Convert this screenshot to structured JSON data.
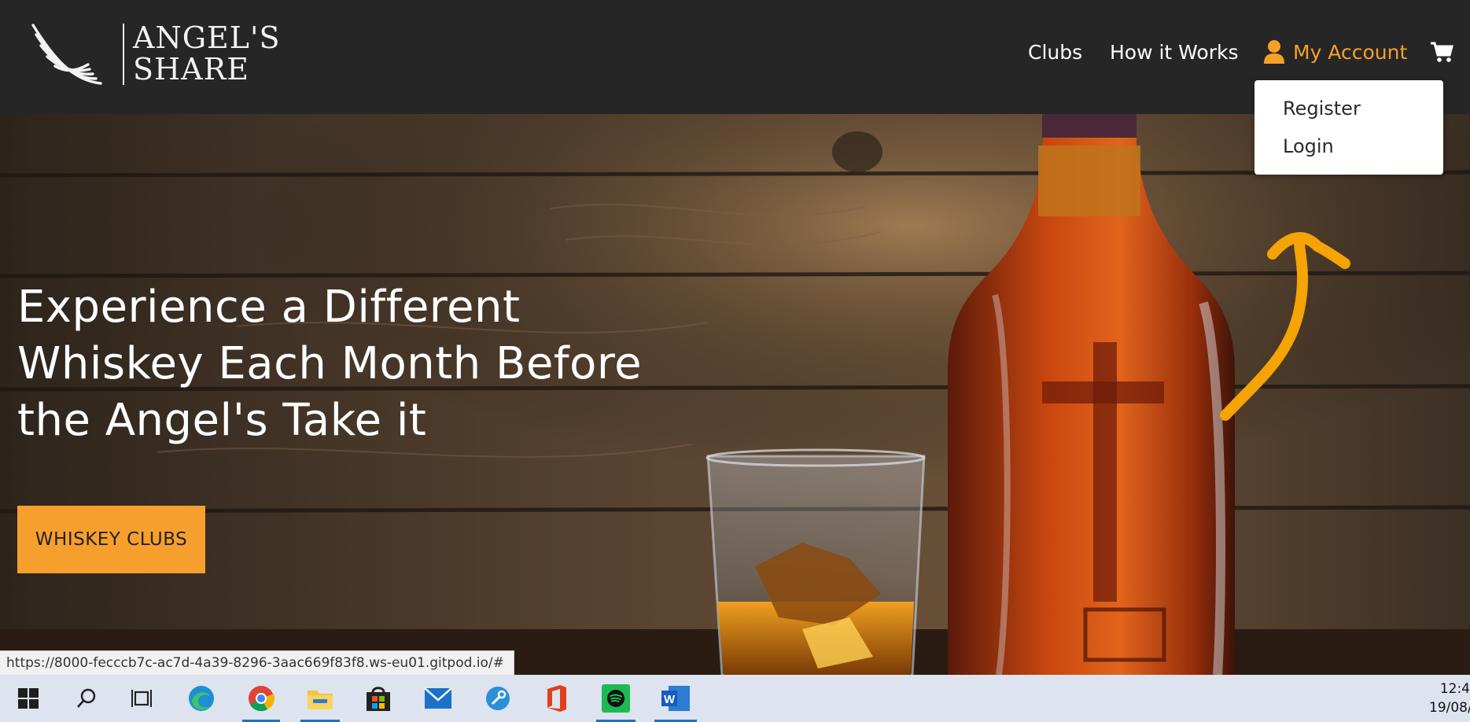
{
  "brand": {
    "logo_line1": "ANGEL'S",
    "logo_line2": "SHARE"
  },
  "nav": {
    "clubs": "Clubs",
    "how_it_works": "How it Works",
    "my_account": "My Account",
    "account_color": "#f5a028"
  },
  "account_menu": {
    "register": "Register",
    "login": "Login"
  },
  "hero": {
    "title_line1": "Experience a Different",
    "title_line2": "Whiskey Each Month Before",
    "title_line3": "the Angel's Take it",
    "cta_label": "WHISKEY CLUBS",
    "cta_color": "#f79f2d"
  },
  "status_bar": {
    "url": "https://8000-fecccb7c-ac7d-4a39-8296-3aac669f83f8.ws-eu01.gitpod.io/#"
  },
  "taskbar": {
    "icons": [
      "windows-start-icon",
      "search-icon",
      "task-view-icon",
      "edge-icon",
      "chrome-icon",
      "file-explorer-icon",
      "store-icon",
      "mail-icon",
      "remote-desktop-icon",
      "office-icon",
      "spotify-icon",
      "word-icon"
    ],
    "clock_time": "12:4",
    "clock_date": "19/08/"
  }
}
